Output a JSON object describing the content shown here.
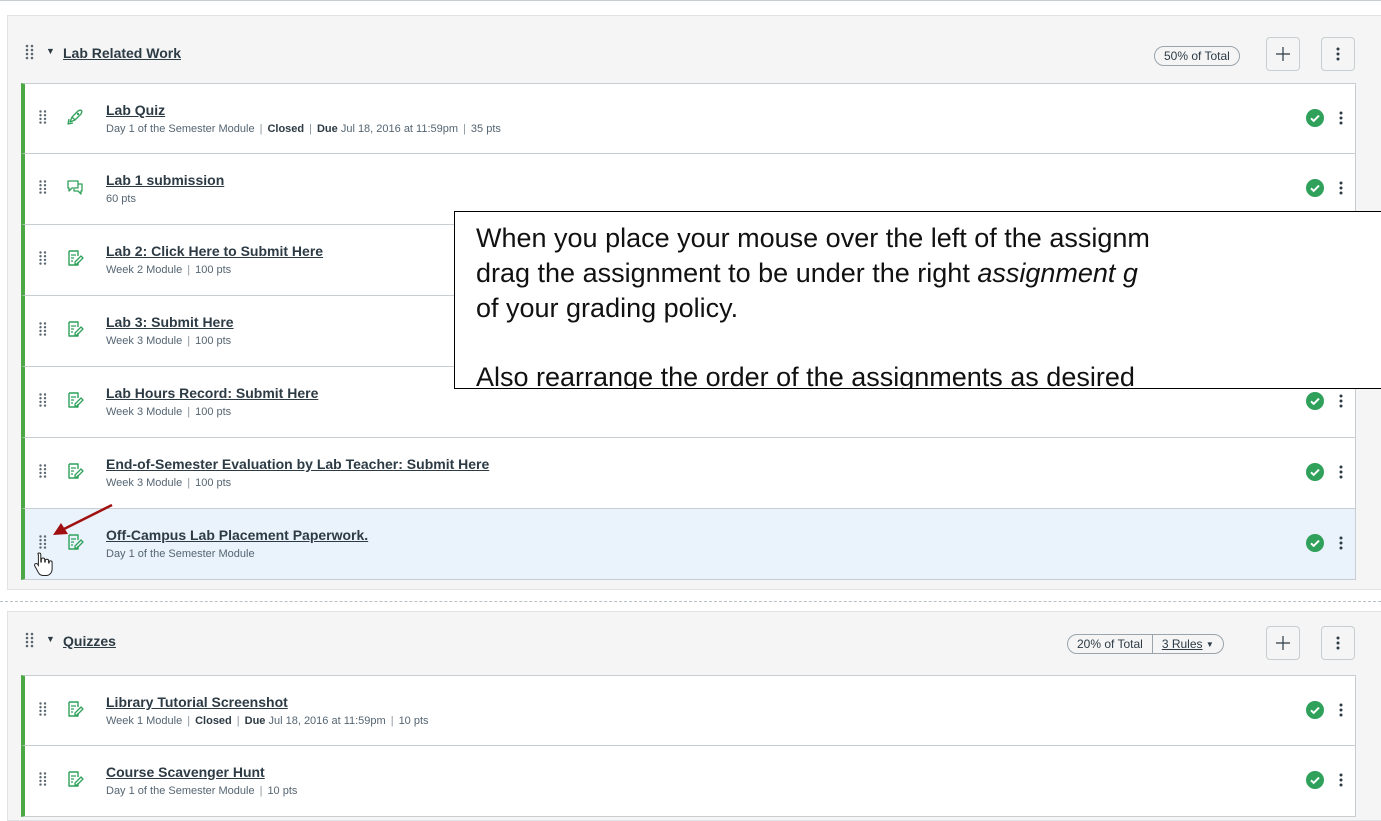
{
  "groups": [
    {
      "name": "Lab Related Work",
      "weight": "50% of Total",
      "assignments": [
        {
          "title": "Lab Quiz",
          "type": "quiz",
          "meta": [
            {
              "text": "Day 1 of the Semester Module"
            },
            {
              "bold": "Closed"
            },
            {
              "bold": "Due",
              "text": " Jul 18, 2016 at 11:59pm"
            },
            {
              "text": "35 pts"
            }
          ]
        },
        {
          "title": "Lab 1 submission",
          "type": "discussion",
          "meta": [
            {
              "text": "60 pts"
            }
          ]
        },
        {
          "title": "Lab 2: Click Here to Submit Here",
          "type": "assignment",
          "meta": [
            {
              "text": "Week 2 Module"
            },
            {
              "text": "100 pts"
            }
          ]
        },
        {
          "title": "Lab 3: Submit Here",
          "type": "assignment",
          "meta": [
            {
              "text": "Week 3 Module"
            },
            {
              "text": "100 pts"
            }
          ]
        },
        {
          "title": "Lab Hours Record: Submit Here",
          "type": "assignment",
          "meta": [
            {
              "text": "Week 3 Module"
            },
            {
              "text": "100 pts"
            }
          ]
        },
        {
          "title": "End-of-Semester Evaluation by Lab Teacher: Submit Here",
          "type": "assignment",
          "meta": [
            {
              "text": "Week 3 Module"
            },
            {
              "text": "100 pts"
            }
          ]
        },
        {
          "title": "Off-Campus Lab Placement Paperwork.",
          "type": "assignment",
          "highlighted": true,
          "meta": [
            {
              "text": "Day 1 of the Semester Module"
            }
          ]
        }
      ]
    },
    {
      "name": "Quizzes",
      "weight": "20% of Total",
      "rules": "3 Rules",
      "assignments": [
        {
          "title": "Library Tutorial Screenshot",
          "type": "assignment",
          "meta": [
            {
              "text": "Week 1 Module"
            },
            {
              "bold": "Closed"
            },
            {
              "bold": "Due",
              "text": " Jul 18, 2016 at 11:59pm"
            },
            {
              "text": "10 pts"
            }
          ]
        },
        {
          "title": "Course Scavenger Hunt",
          "type": "assignment",
          "meta": [
            {
              "text": "Day 1 of the Semester Module"
            },
            {
              "text": "10 pts"
            }
          ]
        }
      ]
    }
  ],
  "callout": {
    "line1": "When you place your mouse over the left of the assignm",
    "line2_before": "drag the assignment to be under the right ",
    "line2_italic": "assignment g",
    "line3": "of your grading policy.",
    "line4": "Also rearrange the order of the assignments as desired"
  },
  "icons": {
    "drag": "drag-handle-icon",
    "quiz": "rocket-quiz-icon",
    "discussion": "discussion-icon",
    "assignment": "assignment-icon",
    "published": "published-check-icon",
    "menu": "kebab-menu-icon",
    "add": "plus-icon",
    "collapse": "caret-down-icon",
    "pointer": "hand-cursor-icon",
    "annotation": "red-arrow-icon"
  },
  "colors": {
    "published": "#2fa15a",
    "border_accent": "#4ca845",
    "highlight_row": "#eaf3fb",
    "arrow": "#a01010"
  }
}
